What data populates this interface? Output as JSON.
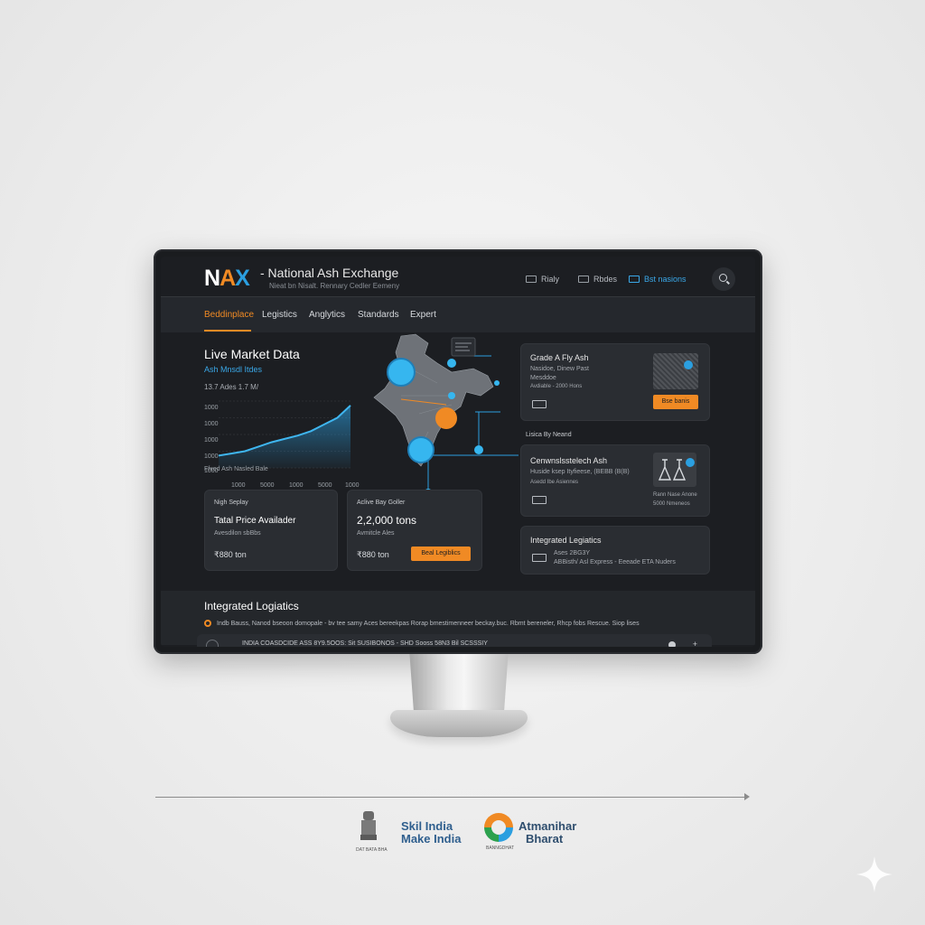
{
  "header": {
    "logo": {
      "n": "N",
      "a": "A",
      "x": "X"
    },
    "brand": "- National Ash Exchange",
    "tagline": "Nieat bn Nisalt. Rennary Cedler Eemeny",
    "nav": [
      {
        "label": "Rialy",
        "icon": "monitor-icon"
      },
      {
        "label": "Rbdes",
        "icon": "truck-icon"
      },
      {
        "label": "Bst nasions",
        "icon": "chart-icon"
      }
    ],
    "search_icon": "search-icon"
  },
  "tabs": [
    "Beddinplace",
    "Legistics",
    "Anglytics",
    "Standards",
    "Expert"
  ],
  "live": {
    "title": "Live Market Data",
    "index_label": "Ash Mnsdl Itdes",
    "value_line": "13.7 Ades   1.7 M/",
    "y_ticks": [
      "1000",
      "1000",
      "1000",
      "1000",
      "1000"
    ],
    "x_ticks": [
      "1000",
      "5000",
      "1000",
      "5000",
      "1000"
    ],
    "chart_values": [
      22,
      26,
      30,
      38,
      46,
      52,
      58,
      66,
      78,
      90,
      112
    ]
  },
  "fixed_label": "Ffxed Ash Nasled Bale",
  "cards": {
    "high_supply": {
      "tag": "Nigh Seplay",
      "title": "Tatal Price Availader",
      "sub": "Avesdilon sbBbs",
      "price": "₹880 ton"
    },
    "active_buy": {
      "tag": "Aclive Bay Goller",
      "title": "2,2,000 tons",
      "sub": "Avmitcle Ales",
      "price": "₹880 ton",
      "button": "Beal Legiblics"
    },
    "grade_a": {
      "title": "Grade A Fly Ash",
      "sub1": "Nasidoe, Dinew Past",
      "sub2": "Mesddoe",
      "sub3": "Avdiable - 2000 Hons",
      "button": "Bse banis"
    },
    "listing_label": "Lisica By Neand",
    "cenosphere": {
      "title": "Cenwnslsstelech Ash",
      "sub1": "Huside ksep Ityfieese, (BEBB (B(B)",
      "sub2": "Asedd Ibe Asiennes",
      "caption1": "Rann Nase Anone",
      "caption2": "5000 Nmeneos"
    },
    "logistics_card": {
      "title": "Integrated Legiatics",
      "sub1": "Ases 2BG3Y",
      "sub2": "ABBisth/ Asl Express - Eeeade ETA Nuders"
    }
  },
  "footer": {
    "section_title": "Integrated Logiatics",
    "ticker": "Indb Bauss, Nanod bseoon domopale - bv tee samy Aces bereekpas Rorap bmestimenneer beckay.buc. Rbmt bereneler, Rhcp fobs Rescue. Siop lises",
    "strip": "INDIA COASDCIDE ASS 8Y9.5OOS: Sit SUSIBONOS - SHD Sooss 58N3 Bil SCSSSIY"
  },
  "bottom": {
    "emblem_caption": "DAT BATA BHA",
    "skill_line1": "Skil India",
    "skill_line2": "Make India",
    "aatm_line1": "Atmanihar",
    "aatm_line2": "Bharat",
    "aatm_caption": "BANNGDHAT"
  },
  "colors": {
    "accent_orange": "#f08a24",
    "accent_blue": "#2b9fe0",
    "panel": "#2a2d32",
    "bg": "#1c1e22"
  }
}
